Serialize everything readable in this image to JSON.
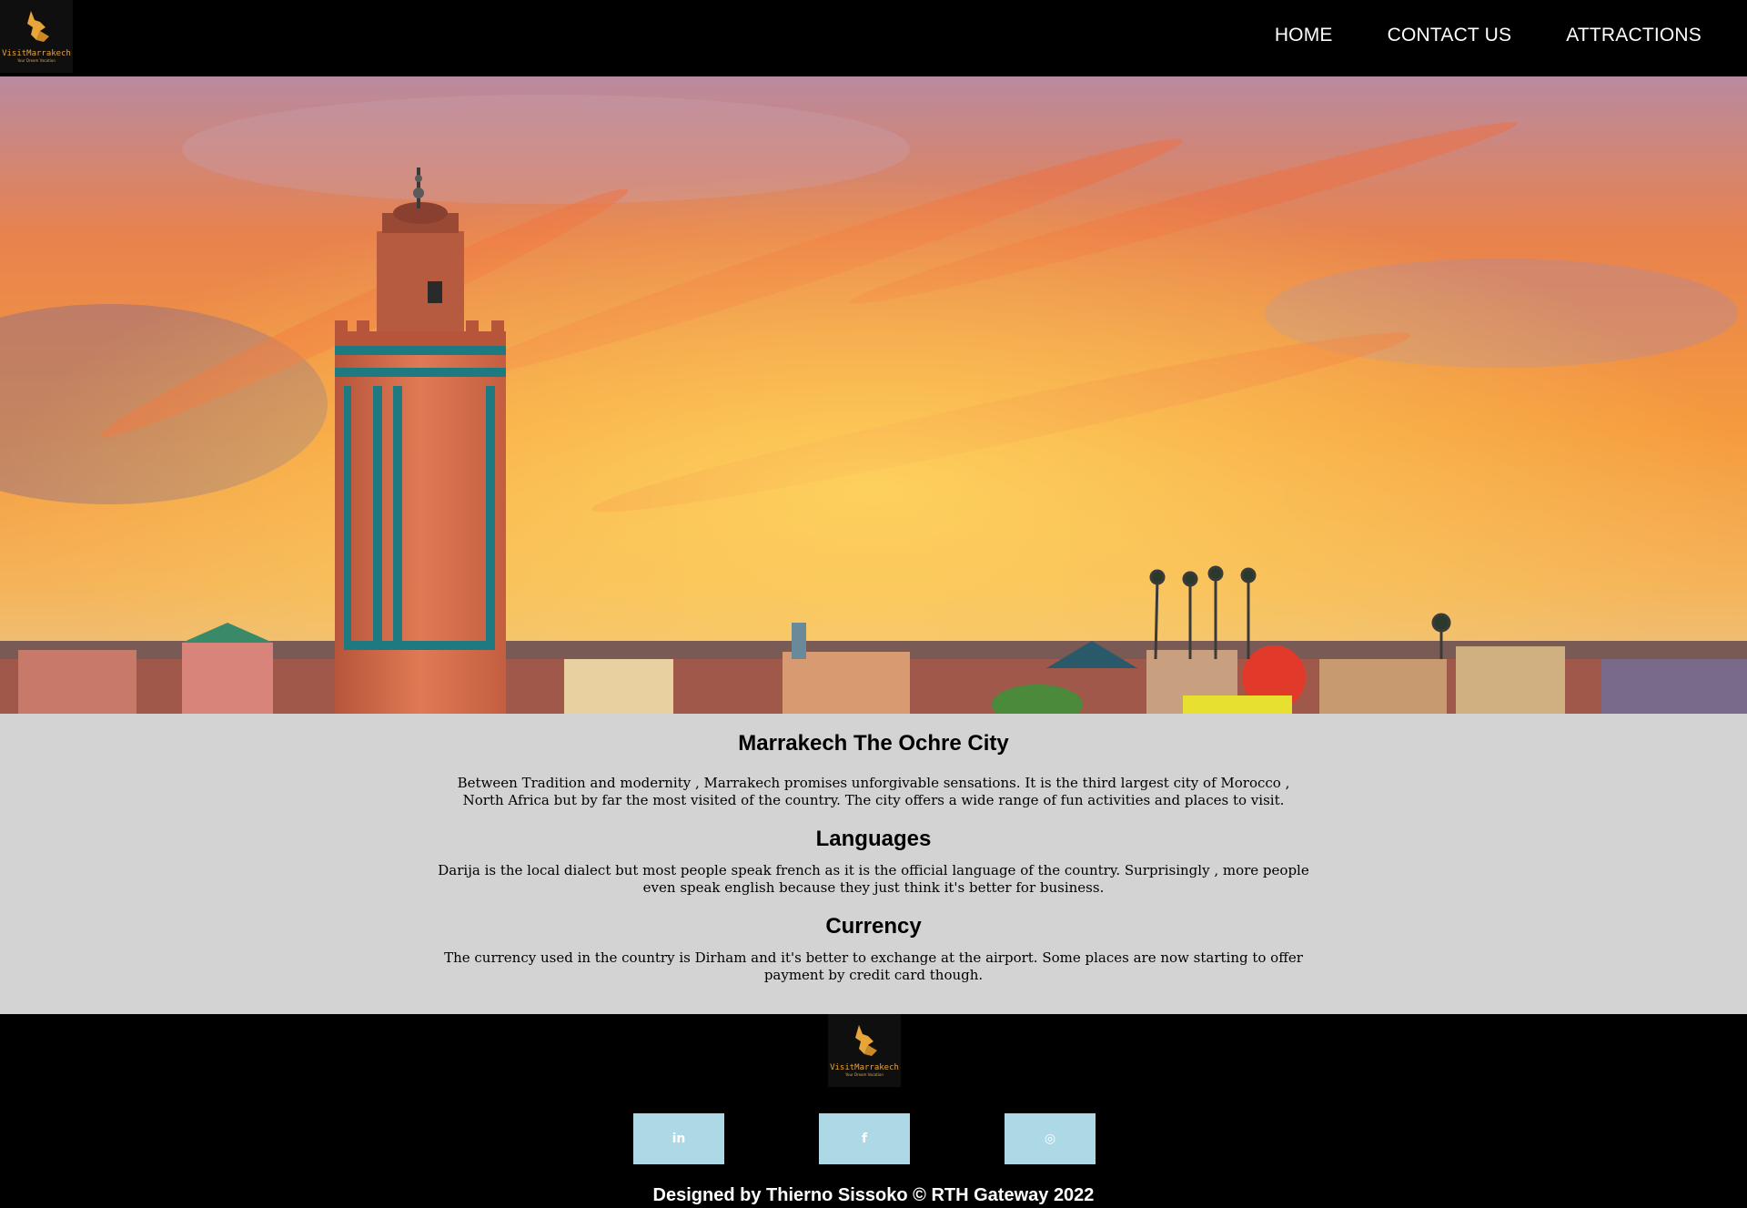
{
  "header": {
    "logo": {
      "brand": "VisitMarrakech",
      "tagline": "Your Dream Vacation"
    },
    "nav": [
      {
        "label": "HOME"
      },
      {
        "label": "CONTACT US"
      },
      {
        "label": "ATTRACTIONS"
      }
    ]
  },
  "hero": {
    "image": "marrakech-minaret-sunset"
  },
  "main": {
    "title": "Marrakech The Ochre City",
    "intro": "Between Tradition and modernity , Marrakech promises unforgivable sensations. It is the third largest city of Morocco , North Africa but by far the most visited of the country. The city offers a wide range of fun activities and places to visit.",
    "sections": [
      {
        "heading": "Languages",
        "body": "Darija is the local dialect but most people speak french as it is the official language of the country. Surprisingly , more people even speak english because they just think it's better for business."
      },
      {
        "heading": "Currency",
        "body": "The currency used in the country is Dirham and it's better to exchange at the airport. Some places are now starting to offer payment by credit card though."
      }
    ]
  },
  "footer": {
    "socials": [
      {
        "name": "linkedin-icon",
        "glyph": "in"
      },
      {
        "name": "facebook-icon",
        "glyph": "f"
      },
      {
        "name": "instagram-icon",
        "glyph": "◎"
      }
    ],
    "credit": "Designed by Thierno Sissoko © RTH Gateway 2022"
  },
  "colors": {
    "header_bg": "#000000",
    "content_bg": "#d3d3d3",
    "social_bg": "#add8e6",
    "logo_gold": "#e8a53a"
  }
}
